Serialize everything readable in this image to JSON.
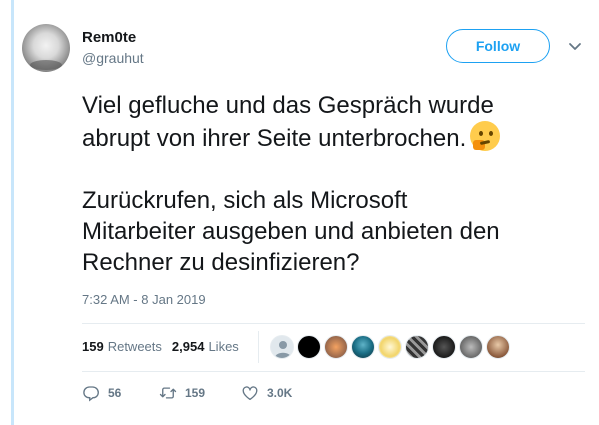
{
  "author": {
    "name": "Rem0te",
    "handle": "@grauhut"
  },
  "follow_label": "Follow",
  "tweet": {
    "paragraph1": "Viel gefluche und das Gespräch wurde\nabrupt von ihrer Seite unterbrochen.",
    "paragraph2": "Zurückrufen, sich als Microsoft\nMitarbeiter ausgeben und anbieten den\nRechner zu desinfizieren?",
    "emoji": "thinking-face"
  },
  "timestamp": "7:32 AM - 8 Jan 2019",
  "stats": {
    "retweets_count": "159",
    "retweets_label": "Retweets",
    "likes_count": "2,954",
    "likes_label": "Likes"
  },
  "likers": [
    {
      "icon": "default-avatar"
    },
    {
      "icon": "black-avatar"
    },
    {
      "icon": "orange-avatar"
    },
    {
      "icon": "teal-avatar"
    },
    {
      "icon": "yellow-avatar"
    },
    {
      "icon": "pattern-avatar"
    },
    {
      "icon": "dark-avatar"
    },
    {
      "icon": "grey-avatar"
    },
    {
      "icon": "photo-avatar"
    }
  ],
  "actions": {
    "reply_count": "56",
    "retweet_count": "159",
    "like_count": "3.0K"
  },
  "colors": {
    "accent": "#1da1f2",
    "secondary_text": "#657786",
    "primary_text": "#14171a"
  }
}
